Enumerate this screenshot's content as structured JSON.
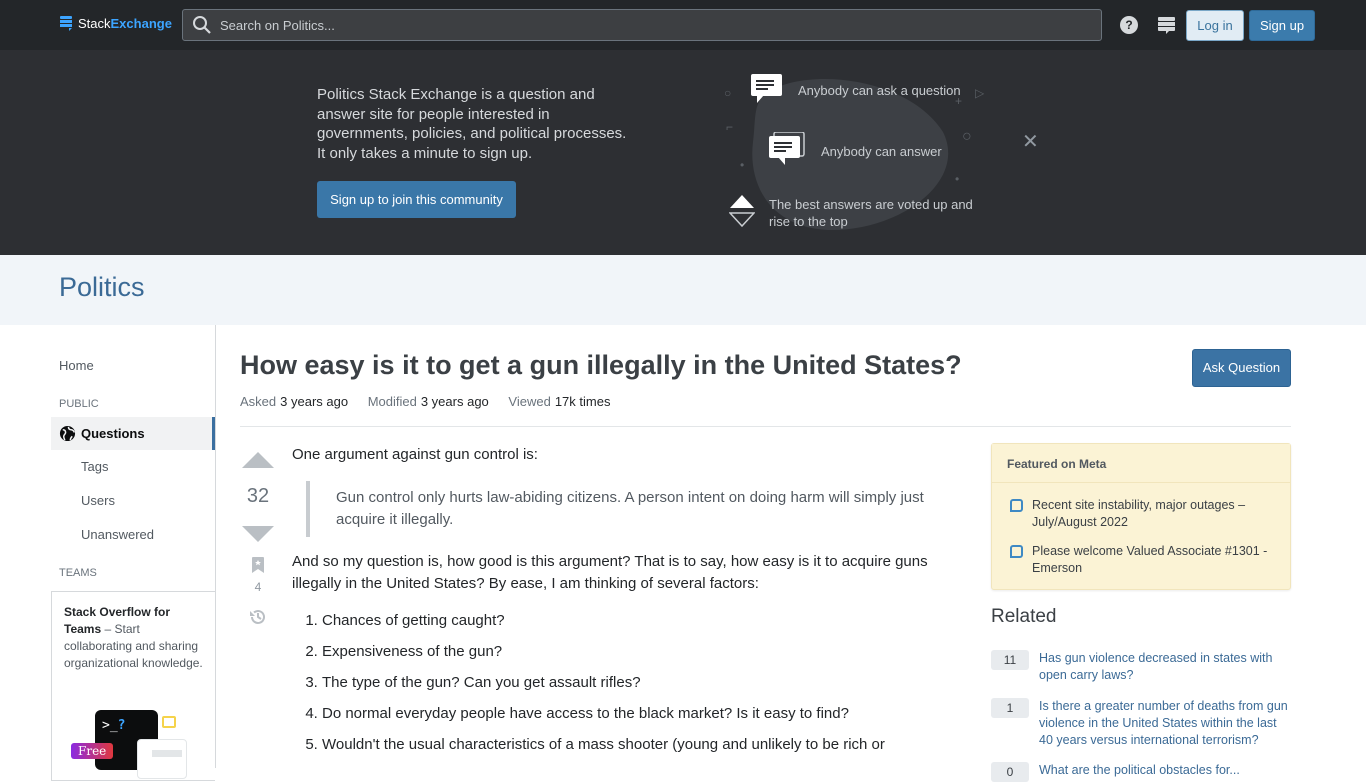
{
  "topbar": {
    "logo_stack": "Stack",
    "logo_exchange": "Exchange",
    "search_placeholder": "Search on Politics...",
    "login_label": "Log in",
    "signup_label": "Sign up"
  },
  "hero": {
    "description": "Politics Stack Exchange is a question and answer site for people interested in governments, policies, and political processes. It only takes a minute to sign up.",
    "cta_label": "Sign up to join this community",
    "features": [
      "Anybody can ask a question",
      "Anybody can answer",
      "The best answers are voted up and rise to the top"
    ]
  },
  "site": {
    "name": "Politics"
  },
  "leftnav": {
    "home": "Home",
    "public_label": "PUBLIC",
    "questions": "Questions",
    "tags": "Tags",
    "users": "Users",
    "unanswered": "Unanswered",
    "teams_label": "TEAMS",
    "teams_title": "Stack Overflow for Teams",
    "teams_text": " – Start collaborating and sharing organizational knowledge.",
    "teams_badge": "Free"
  },
  "question": {
    "title": "How easy is it to get a gun illegally in the United States?",
    "asked_label": "Asked",
    "asked_value": "3 years ago",
    "modified_label": "Modified",
    "modified_value": "3 years ago",
    "viewed_label": "Viewed",
    "viewed_value": "17k times",
    "ask_button": "Ask Question",
    "votes": "32",
    "bookmarks": "4",
    "intro": "One argument against gun control is:",
    "quote": "Gun control only hurts law-abiding citizens. A person intent on doing harm will simply just acquire it illegally.",
    "body": "And so my question is, how good is this argument? That is to say, how easy is it to acquire guns illegally in the United States? By ease, I am thinking of several factors:",
    "factors": [
      "Chances of getting caught?",
      "Expensiveness of the gun?",
      "The type of the gun? Can you get assault rifles?",
      "Do normal everyday people have access to the black market? Is it easy to find?",
      "Wouldn't the usual characteristics of a mass shooter (young and unlikely to be rich or"
    ]
  },
  "sidebar": {
    "featured_title": "Featured on Meta",
    "featured": [
      "Recent site instability, major outages – July/August 2022",
      "Please welcome Valued Associate #1301 - Emerson"
    ],
    "related_title": "Related",
    "related": [
      {
        "count": "11",
        "title": "Has gun violence decreased in states with open carry laws?"
      },
      {
        "count": "1",
        "title": "Is there a greater number of deaths from gun violence in the United States within the last 40 years versus international terrorism?"
      },
      {
        "count": "0",
        "title": "What are the political obstacles for..."
      }
    ]
  }
}
